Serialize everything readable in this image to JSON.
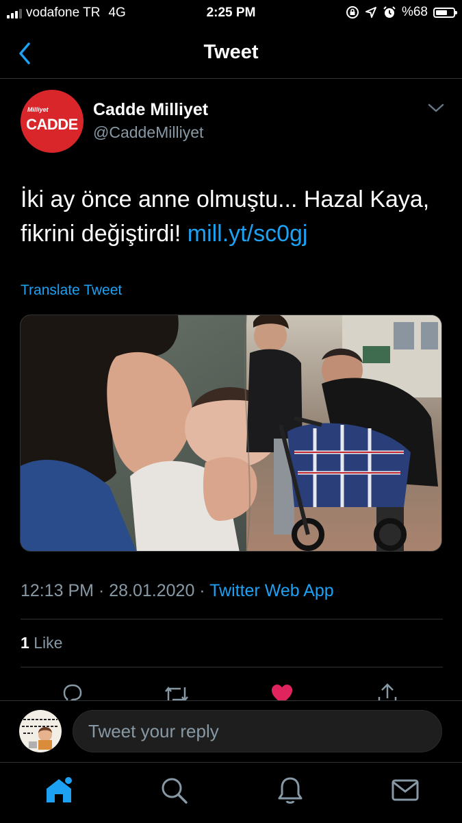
{
  "status_bar": {
    "carrier": "vodafone TR",
    "network": "4G",
    "time": "2:25 PM",
    "battery_percent": "%68",
    "battery_level": 0.68,
    "signal_bars": 3,
    "icons": [
      "screen-rotation-lock-icon",
      "location-arrow-icon",
      "alarm-icon"
    ]
  },
  "nav": {
    "title": "Tweet",
    "back_icon": "chevron-left-icon"
  },
  "author": {
    "display_name": "Cadde Milliyet",
    "handle": "@CaddeMilliyet",
    "avatar_brand": "Milliyet",
    "avatar_word": "CADDE",
    "avatar_color": "#d9262b"
  },
  "tweet": {
    "text": "İki ay önce anne olmuştu... Hazal Kaya, fikrini değiştirdi! ",
    "link": "mill.yt/sc0gj",
    "translate_label": "Translate Tweet"
  },
  "meta": {
    "time": "12:13 PM",
    "date": "28.01.2020",
    "separator": " · ",
    "source": "Twitter Web App"
  },
  "stats": {
    "likes_count": "1",
    "likes_label": "Like"
  },
  "actions": [
    "reply-icon",
    "retweet-icon",
    "like-icon",
    "share-icon"
  ],
  "reply": {
    "placeholder": "Tweet your reply"
  },
  "tab_bar": [
    "home-icon",
    "search-icon",
    "notifications-icon",
    "messages-icon"
  ],
  "colors": {
    "accent": "#1da1f2",
    "secondary_text": "#8899a6",
    "like": "#e0245e",
    "background": "#000000"
  }
}
